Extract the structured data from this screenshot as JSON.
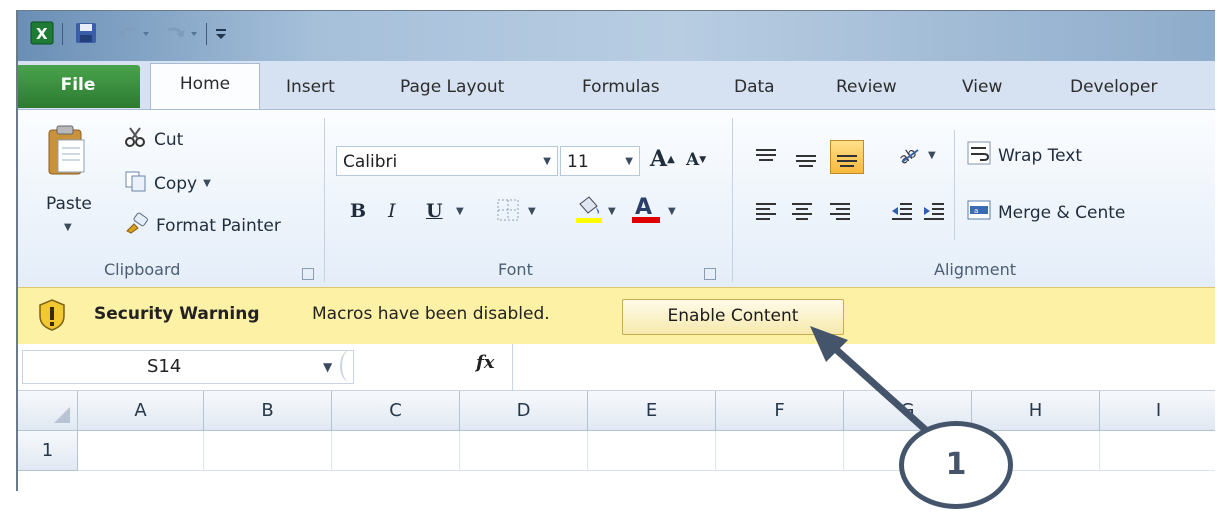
{
  "quick_access": {
    "icons": [
      "excel-logo-icon",
      "save-icon",
      "undo-icon",
      "redo-icon",
      "customize-icon"
    ]
  },
  "tabs": [
    {
      "label": "File"
    },
    {
      "label": "Home"
    },
    {
      "label": "Insert"
    },
    {
      "label": "Page Layout"
    },
    {
      "label": "Formulas"
    },
    {
      "label": "Data"
    },
    {
      "label": "Review"
    },
    {
      "label": "View"
    },
    {
      "label": "Developer"
    }
  ],
  "clipboard": {
    "paste_label": "Paste",
    "cut_label": "Cut",
    "copy_label": "Copy",
    "format_painter_label": "Format Painter",
    "group_label": "Clipboard"
  },
  "font": {
    "font_name": "Calibri",
    "font_size": "11",
    "bold_label": "B",
    "italic_label": "I",
    "underline_label": "U",
    "group_label": "Font"
  },
  "alignment": {
    "wrap_text_label": "Wrap Text",
    "merge_label": "Merge & Cente",
    "group_label": "Alignment"
  },
  "security_bar": {
    "title": "Security Warning",
    "message": "Macros have been disabled.",
    "button_label": "Enable Content"
  },
  "formula_bar": {
    "name_box": "S14",
    "fx_label": "fx",
    "formula": ""
  },
  "grid": {
    "columns": [
      "A",
      "B",
      "C",
      "D",
      "E",
      "F",
      "G",
      "H",
      "I"
    ],
    "rows": [
      "1"
    ]
  },
  "callout": {
    "number": "1"
  },
  "colors": {
    "file_tab": "#2d7a31",
    "security_bar": "#fdf1a6",
    "callout": "#44546a",
    "font_color_underline": "#e00000",
    "highlight_underline": "#ffff00"
  }
}
